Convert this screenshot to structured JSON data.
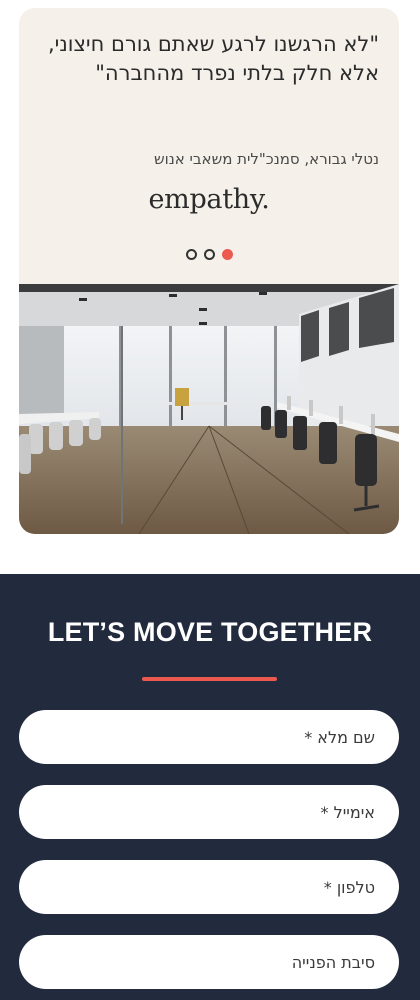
{
  "testimonial": {
    "quote": "\"לא הרגשנו לרגע שאתם גורם חיצוני, אלא חלק בלתי נפרד מהחברה\"",
    "author": "נטלי גבורא, סמנכ\"לית משאבי אנוש",
    "company_logo_text": "empathy.",
    "carousel": {
      "dot_count": 3,
      "active_index": 2,
      "active_color": "#ec5a4f"
    }
  },
  "contact_form": {
    "title": "LET’S MOVE TOGETHER",
    "accent_color": "#ec5a4f",
    "background_color": "#222a3e",
    "fields": {
      "full_name_placeholder": "שם מלא *",
      "email_placeholder": "אימייל *",
      "phone_placeholder": "טלפון *",
      "reason_placeholder": "סיבת הפנייה"
    }
  }
}
